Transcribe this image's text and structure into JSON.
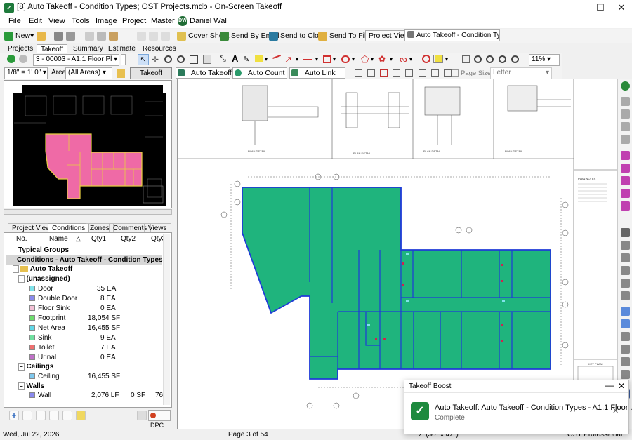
{
  "window": {
    "title": "[8] Auto Takeoff - Condition Types; OST Projects.mdb - On-Screen Takeoff"
  },
  "menu": [
    "File",
    "Edit",
    "View",
    "Tools",
    "Image",
    "Project",
    "Master"
  ],
  "user": {
    "initials": "DW",
    "name": "Daniel Wal"
  },
  "toolbar1": {
    "new": "New",
    "cover_sheet": "Cover Sheet",
    "send_email": "Send By Email",
    "send_cloud": "Send to Cloud",
    "send_file": "Send To File",
    "project_view": "Project View",
    "project_view_select": "Auto Takeoff - Condition Typ"
  },
  "tabs": [
    "Projects",
    "Takeoff",
    "Summary",
    "Estimate",
    "Resources"
  ],
  "page_select": "3 - 00003 - A1.1 Floor Pl",
  "zoom": "11%",
  "scale": "1/8\" = 1' 0\"",
  "area_label": "Area",
  "area_select": "(All Areas)",
  "takeoff_boost": "Takeoff Boost™",
  "auto_takeoff": "Auto Takeoff",
  "auto_count": "Auto Count",
  "auto_link": "Auto Link",
  "page_size_label": "Page Size",
  "page_size": "Letter",
  "panel_tabs": [
    "Project View",
    "Conditions",
    "Zones",
    "Comments",
    "Views"
  ],
  "grid_headers": [
    "No.",
    "Name",
    "Qty1",
    "Qty2",
    "Qty3"
  ],
  "grid": {
    "typical_groups": "Typical Groups",
    "conditions_bar": "Conditions - Auto Takeoff - Condition Types",
    "auto_takeoff_folder": "Auto Takeoff",
    "unassigned": "(unassigned)",
    "items": [
      {
        "name": "Door",
        "qty1": "35 EA",
        "color": "#7fe3ea"
      },
      {
        "name": "Double Door",
        "qty1": "8 EA",
        "color": "#8a8aee"
      },
      {
        "name": "Floor Sink",
        "qty1": "0 EA",
        "color": "#f4c1d6"
      },
      {
        "name": "Footprint",
        "qty1": "18,054 SF",
        "color": "#6ddf6d"
      },
      {
        "name": "Net Area",
        "qty1": "16,455 SF",
        "color": "#60d8e8"
      },
      {
        "name": "Sink",
        "qty1": "9 EA",
        "color": "#70e0a0"
      },
      {
        "name": "Toilet",
        "qty1": "7 EA",
        "color": "#f07070"
      },
      {
        "name": "Urinal",
        "qty1": "0 EA",
        "color": "#c070c8"
      }
    ],
    "ceilings_group": "Ceilings",
    "ceiling": {
      "name": "Ceiling",
      "qty1": "16,455 SF",
      "color": "#7fc8ee"
    },
    "walls_group": "Walls",
    "wall": {
      "name": "Wall",
      "qty1": "2,076 LF",
      "qty2": "0 SF",
      "qty3": "76",
      "color": "#8a8aee"
    }
  },
  "dpc": "DPC",
  "drawing_labels": {
    "plan_detail": "PLAN DETAIL",
    "plan_notes": "PLAN NOTES",
    "key_plan": "KEY PLAN"
  },
  "status": {
    "date": "Wed, Jul 22, 2026",
    "page": "Page 3 of 54",
    "dims": "2' (30\" x 42\")",
    "edition": "OST Professional"
  },
  "toast": {
    "header": "Takeoff Boost",
    "title": "Auto Takeoff: Auto Takeoff - Condition Types - A1.1 Floor ...",
    "status": "Complete"
  }
}
